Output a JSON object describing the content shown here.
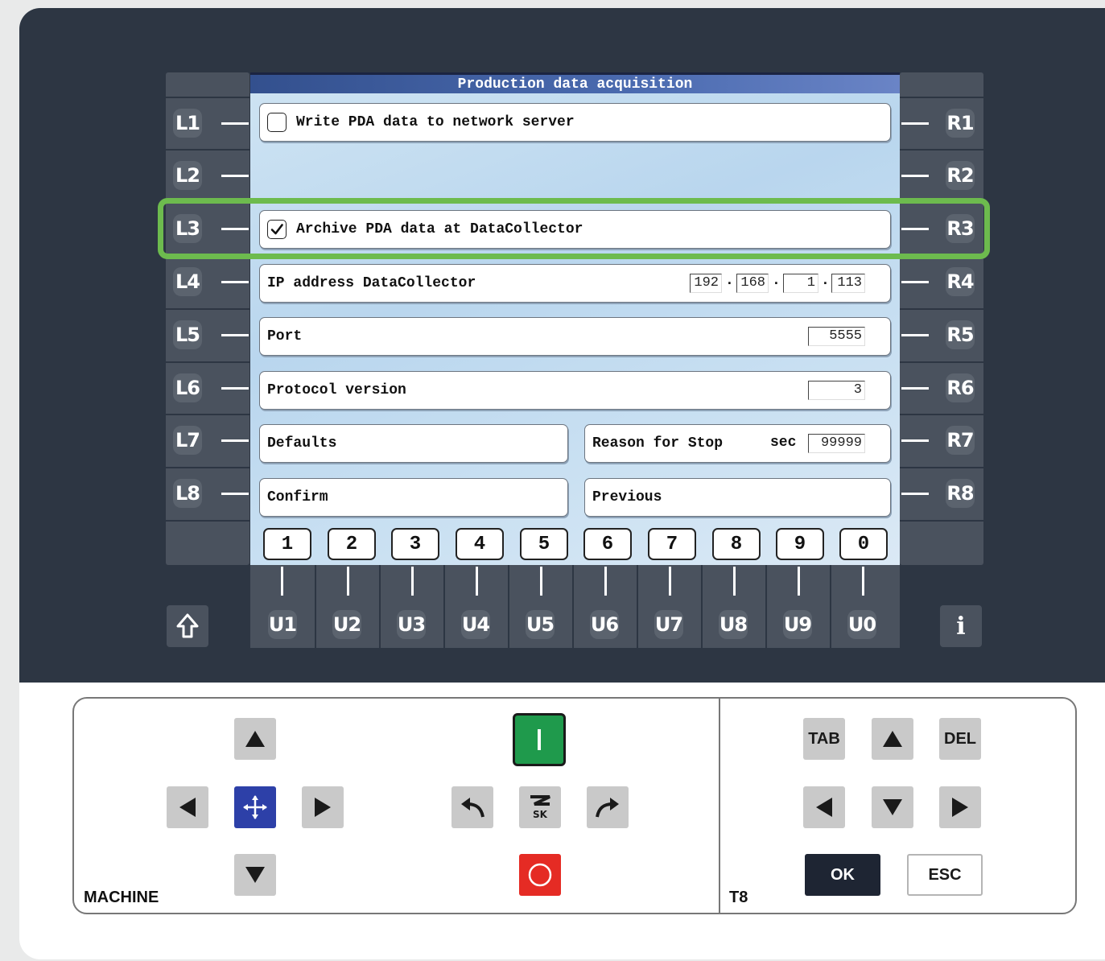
{
  "screen": {
    "title": "Production data acquisition",
    "rows": {
      "write_pda": {
        "label": "Write PDA data to network server",
        "checked": false
      },
      "archive_pda": {
        "label": "Archive PDA data at DataCollector",
        "checked": true
      },
      "ip": {
        "label": "IP address DataCollector",
        "octets": [
          "192",
          "168",
          "1",
          "113"
        ],
        "sep": "."
      },
      "port": {
        "label": "Port",
        "value": "5555"
      },
      "protocol": {
        "label": "Protocol version",
        "value": "3"
      },
      "defaults": {
        "label": "Defaults"
      },
      "reason": {
        "label": "Reason for Stop",
        "unit": "sec",
        "value": "99999"
      },
      "confirm": {
        "label": "Confirm"
      },
      "previous": {
        "label": "Previous"
      }
    },
    "number_keys": [
      "1",
      "2",
      "3",
      "4",
      "5",
      "6",
      "7",
      "8",
      "9",
      "0"
    ]
  },
  "left_keys": [
    "L1",
    "L2",
    "L3",
    "L4",
    "L5",
    "L6",
    "L7",
    "L8"
  ],
  "right_keys": [
    "R1",
    "R2",
    "R3",
    "R4",
    "R5",
    "R6",
    "R7",
    "R8"
  ],
  "u_keys": [
    "U1",
    "U2",
    "U3",
    "U4",
    "U5",
    "U6",
    "U7",
    "U8",
    "U9",
    "U0"
  ],
  "info_key": "i",
  "panel": {
    "machine_label": "MACHINE",
    "t8_label": "T8",
    "tab_label": "TAB",
    "del_label": "DEL",
    "ok_label": "OK",
    "esc_label": "ESC"
  },
  "colors": {
    "highlight": "#6dbb4e",
    "start_button": "#1f9a4c",
    "stop_button": "#e52b24",
    "move_button": "#2d40a8"
  }
}
